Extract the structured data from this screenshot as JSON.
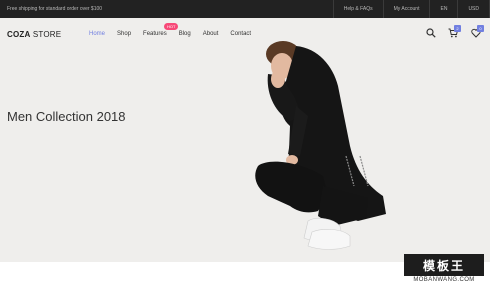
{
  "topbar": {
    "promo": "Free shipping for standard order over $100",
    "links": [
      "Help & FAQs",
      "My Account",
      "EN",
      "USD"
    ]
  },
  "logo": {
    "bold": "COZA",
    "rest": " STORE"
  },
  "nav": {
    "items": [
      "Home",
      "Shop",
      "Features",
      "Blog",
      "About",
      "Contact"
    ],
    "active": "Home",
    "hot_badge": "HOT"
  },
  "header_icons": {
    "search": "search-icon",
    "cart": "cart-icon",
    "cart_count": "2",
    "wishlist": "heart-icon",
    "wishlist_count": "0"
  },
  "hero": {
    "title": "Men Collection 2018",
    "background": "#efeeec",
    "accent": "#717fe0"
  },
  "watermark": {
    "stamp": "模板王",
    "url": "MOBANWANG.COM"
  }
}
